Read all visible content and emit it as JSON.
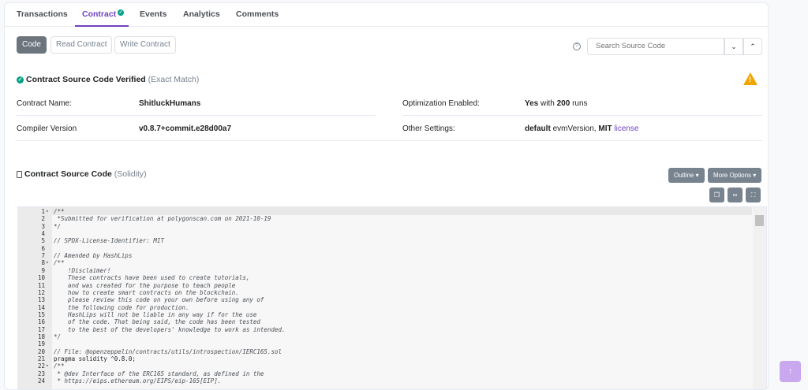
{
  "tabs": [
    {
      "label": "Transactions"
    },
    {
      "label": "Contract"
    },
    {
      "label": "Events"
    },
    {
      "label": "Analytics"
    },
    {
      "label": "Comments"
    }
  ],
  "code_buttons": {
    "code": "Code",
    "read": "Read Contract",
    "write": "Write Contract"
  },
  "search": {
    "placeholder": "Search Source Code",
    "help": "?"
  },
  "verified": {
    "title": "Contract Source Code Verified",
    "sub": "(Exact Match)"
  },
  "info": {
    "contract_name_label": "Contract Name:",
    "contract_name": "ShitluckHumans",
    "compiler_label": "Compiler Version",
    "compiler": "v0.8.7+commit.e28d00a7",
    "optimization_label": "Optimization Enabled:",
    "optimization_yes": "Yes",
    "optimization_with": "with",
    "optimization_runs": "200",
    "optimization_runs_word": "runs",
    "other_label": "Other Settings:",
    "other_default": "default",
    "other_evm": "evmVersion,",
    "other_mit": "MIT",
    "other_license": "license"
  },
  "source": {
    "title": "Contract Source Code",
    "sub": "(Solidity)",
    "outline": "Outline",
    "more": "More Options"
  },
  "code_lines": [
    {
      "n": "1",
      "fold": true,
      "text": "/**",
      "type": "comment"
    },
    {
      "n": "2",
      "fold": false,
      "text": " *Submitted for verification at polygonscan.com on 2021-10-19",
      "type": "comment"
    },
    {
      "n": "3",
      "fold": false,
      "text": "*/",
      "type": "comment"
    },
    {
      "n": "4",
      "fold": false,
      "text": "",
      "type": "plain"
    },
    {
      "n": "5",
      "fold": false,
      "text": "// SPDX-License-Identifier: MIT",
      "type": "comment"
    },
    {
      "n": "6",
      "fold": false,
      "text": "",
      "type": "plain"
    },
    {
      "n": "7",
      "fold": false,
      "text": "// Amended by HashLips",
      "type": "comment"
    },
    {
      "n": "8",
      "fold": true,
      "text": "/**",
      "type": "comment"
    },
    {
      "n": "9",
      "fold": false,
      "text": "    !Disclaimer!",
      "type": "comment"
    },
    {
      "n": "10",
      "fold": false,
      "text": "    These contracts have been used to create tutorials,",
      "type": "comment"
    },
    {
      "n": "11",
      "fold": false,
      "text": "    and was created for the purpose to teach people",
      "type": "comment"
    },
    {
      "n": "12",
      "fold": false,
      "text": "    how to create smart contracts on the blockchain.",
      "type": "comment"
    },
    {
      "n": "13",
      "fold": false,
      "text": "    please review this code on your own before using any of",
      "type": "comment"
    },
    {
      "n": "14",
      "fold": false,
      "text": "    the following code for production.",
      "type": "comment"
    },
    {
      "n": "15",
      "fold": false,
      "text": "    HashLips will not be liable in any way if for the use",
      "type": "comment"
    },
    {
      "n": "16",
      "fold": false,
      "text": "    of the code. That being said, the code has been tested",
      "type": "comment"
    },
    {
      "n": "17",
      "fold": false,
      "text": "    to the best of the developers' knowledge to work as intended.",
      "type": "comment"
    },
    {
      "n": "18",
      "fold": false,
      "text": "*/",
      "type": "comment"
    },
    {
      "n": "19",
      "fold": false,
      "text": "",
      "type": "plain"
    },
    {
      "n": "20",
      "fold": false,
      "text": "// File: @openzeppelin/contracts/utils/introspection/IERC165.sol",
      "type": "comment"
    },
    {
      "n": "21",
      "fold": false,
      "text": "pragma solidity ^0.8.0;",
      "type": "plain"
    },
    {
      "n": "22",
      "fold": true,
      "text": "/**",
      "type": "comment"
    },
    {
      "n": "23",
      "fold": false,
      "text": " * @dev Interface of the ERC165 standard, as defined in the",
      "type": "comment"
    },
    {
      "n": "24",
      "fold": false,
      "text": " * https://eips.ethereum.org/EIPS/eip-165[EIP].",
      "type": "comment"
    }
  ],
  "colors": {
    "accent": "#6f42c1",
    "verified": "#00a186",
    "warning": "#f0a500"
  }
}
